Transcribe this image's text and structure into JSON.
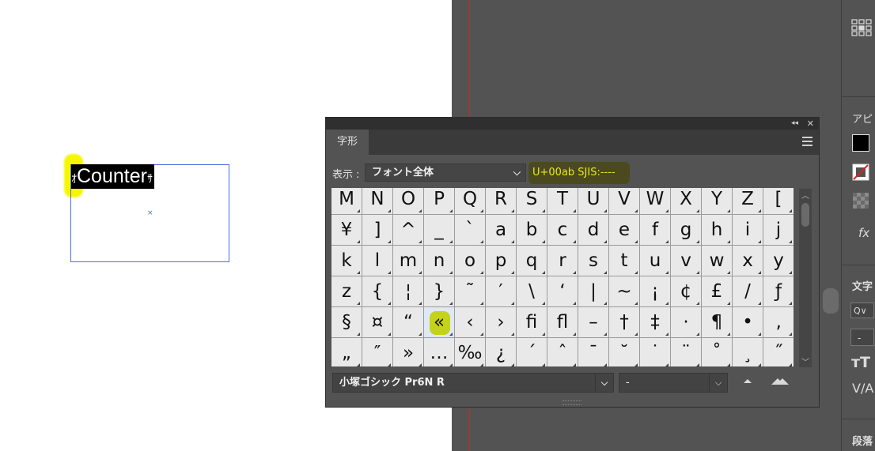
{
  "artboard": {
    "text_prefix_glyph": "ｵ",
    "selected_text": "Counter",
    "text_suffix_glyph": "ｻ",
    "frame_center_mark": "×"
  },
  "right_panel": {
    "appearance_label": "アピ",
    "fx_label": "fx",
    "character_label": "文字",
    "search_label": "Q∨",
    "font_size_value": "-",
    "paragraph_label": "段落"
  },
  "glyphs_panel": {
    "collapse_icon": "◂◂",
    "close_icon": "✕",
    "tab_label": "字形",
    "show_label": "表示 :",
    "show_value": "フォント全体",
    "code_info": "U+00ab SJIS:----",
    "glyph_rows": [
      [
        "M",
        "N",
        "O",
        "P",
        "Q",
        "R",
        "S",
        "T",
        "U",
        "V",
        "W",
        "X",
        "Y",
        "Z",
        "["
      ],
      [
        "¥",
        "]",
        "^",
        "_",
        "`",
        "a",
        "b",
        "c",
        "d",
        "e",
        "f",
        "g",
        "h",
        "i",
        "j"
      ],
      [
        "k",
        "l",
        "m",
        "n",
        "o",
        "p",
        "q",
        "r",
        "s",
        "t",
        "u",
        "v",
        "w",
        "x",
        "y"
      ],
      [
        "z",
        "{",
        "¦",
        "}",
        "˜",
        "′",
        "\\",
        "‘",
        "|",
        "~",
        "¡",
        "¢",
        "£",
        "/",
        "ƒ"
      ],
      [
        "§",
        "¤",
        "“",
        "«",
        "‹",
        "›",
        "ﬁ",
        "ﬂ",
        "–",
        "†",
        "‡",
        "·",
        "¶",
        "•",
        "‚"
      ],
      [
        "„",
        "″",
        "»",
        "…",
        "‰",
        "¿",
        "´",
        "ˆ",
        "¯",
        "˘",
        "˙",
        "¨",
        "˚",
        "¸",
        "˝"
      ]
    ],
    "selected_glyph": "«",
    "font_family": "小塚ゴシック Pr6N R",
    "font_style": "-"
  },
  "colors": {
    "pasteboard": "#535353",
    "highlight_yellow": "#f6f600",
    "code_text": "#e8e81c",
    "frame_blue": "#4a6fd8"
  }
}
